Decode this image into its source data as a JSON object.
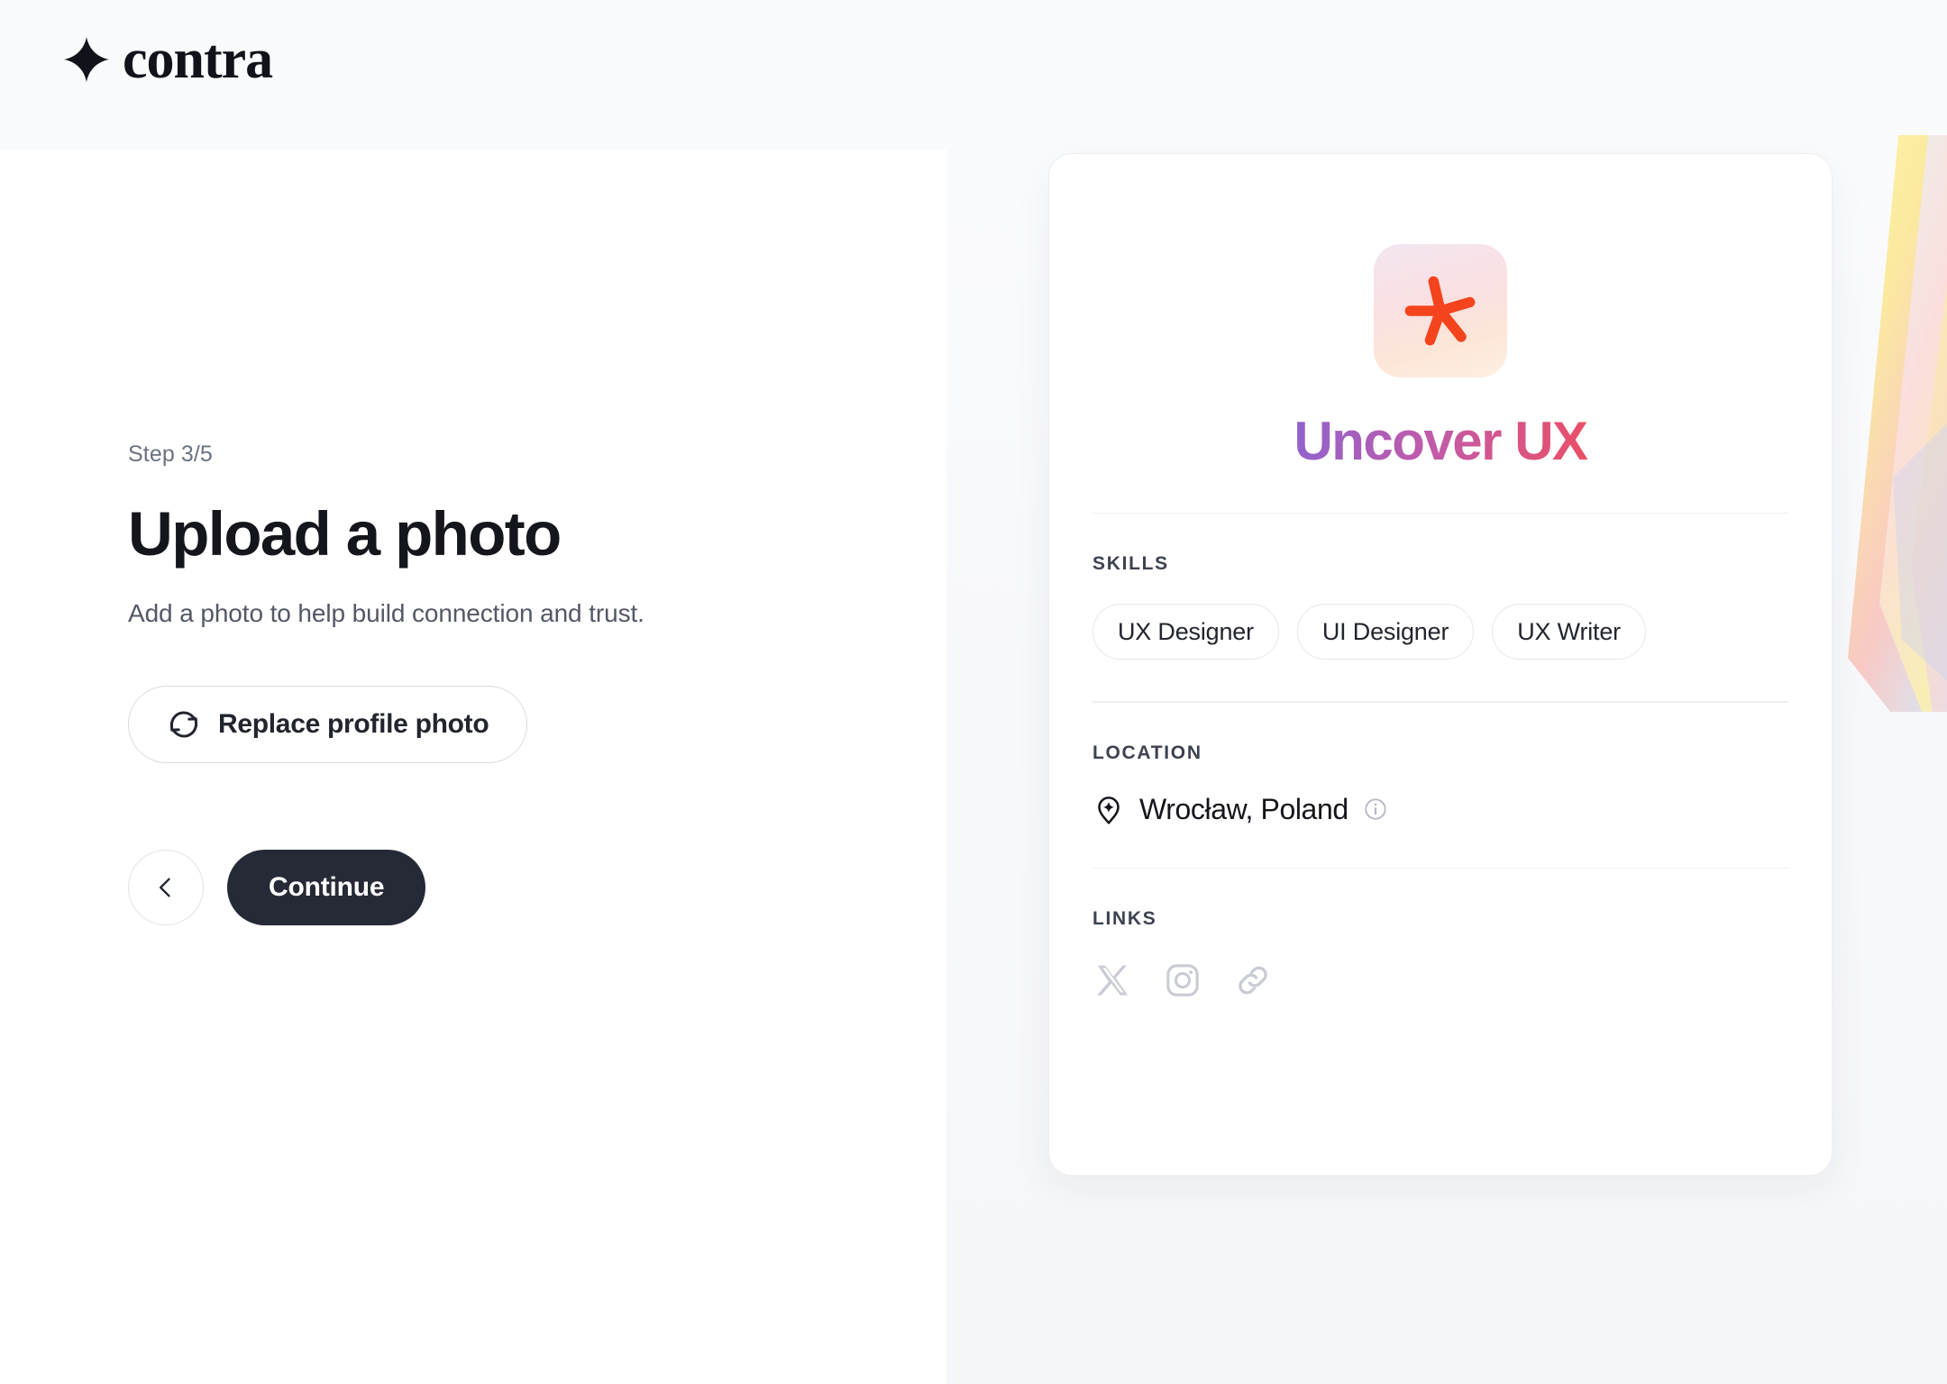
{
  "brand": {
    "name": "contra",
    "logo_icon": "four-point-star-icon"
  },
  "onboarding": {
    "step_label": "Step 3/5",
    "title": "Upload a photo",
    "subtitle": "Add a photo to help build connection and trust.",
    "replace_photo_label": "Replace profile photo",
    "replace_photo_icon": "refresh-icon",
    "back_icon": "chevron-left-icon",
    "continue_label": "Continue"
  },
  "profile_card": {
    "avatar_icon": "asterisk-icon",
    "avatar_accent_color": "#F4441E",
    "name": "Uncover UX",
    "name_gradient_start": "#6A6AE2",
    "name_gradient_end": "#F4623A",
    "skills": {
      "label": "SKILLS",
      "items": [
        {
          "label": "UX Designer"
        },
        {
          "label": "UI Designer"
        },
        {
          "label": "UX Writer"
        }
      ]
    },
    "location": {
      "label": "LOCATION",
      "pin_icon": "map-pin-star-icon",
      "value": "Wrocław, Poland",
      "info_icon": "info-icon"
    },
    "links": {
      "label": "LINKS",
      "items": [
        {
          "icon": "x-twitter-icon"
        },
        {
          "icon": "instagram-icon"
        },
        {
          "icon": "link-chain-icon"
        }
      ]
    }
  },
  "decoration": {
    "iridescent_shape": "holographic-prism-decoration"
  }
}
